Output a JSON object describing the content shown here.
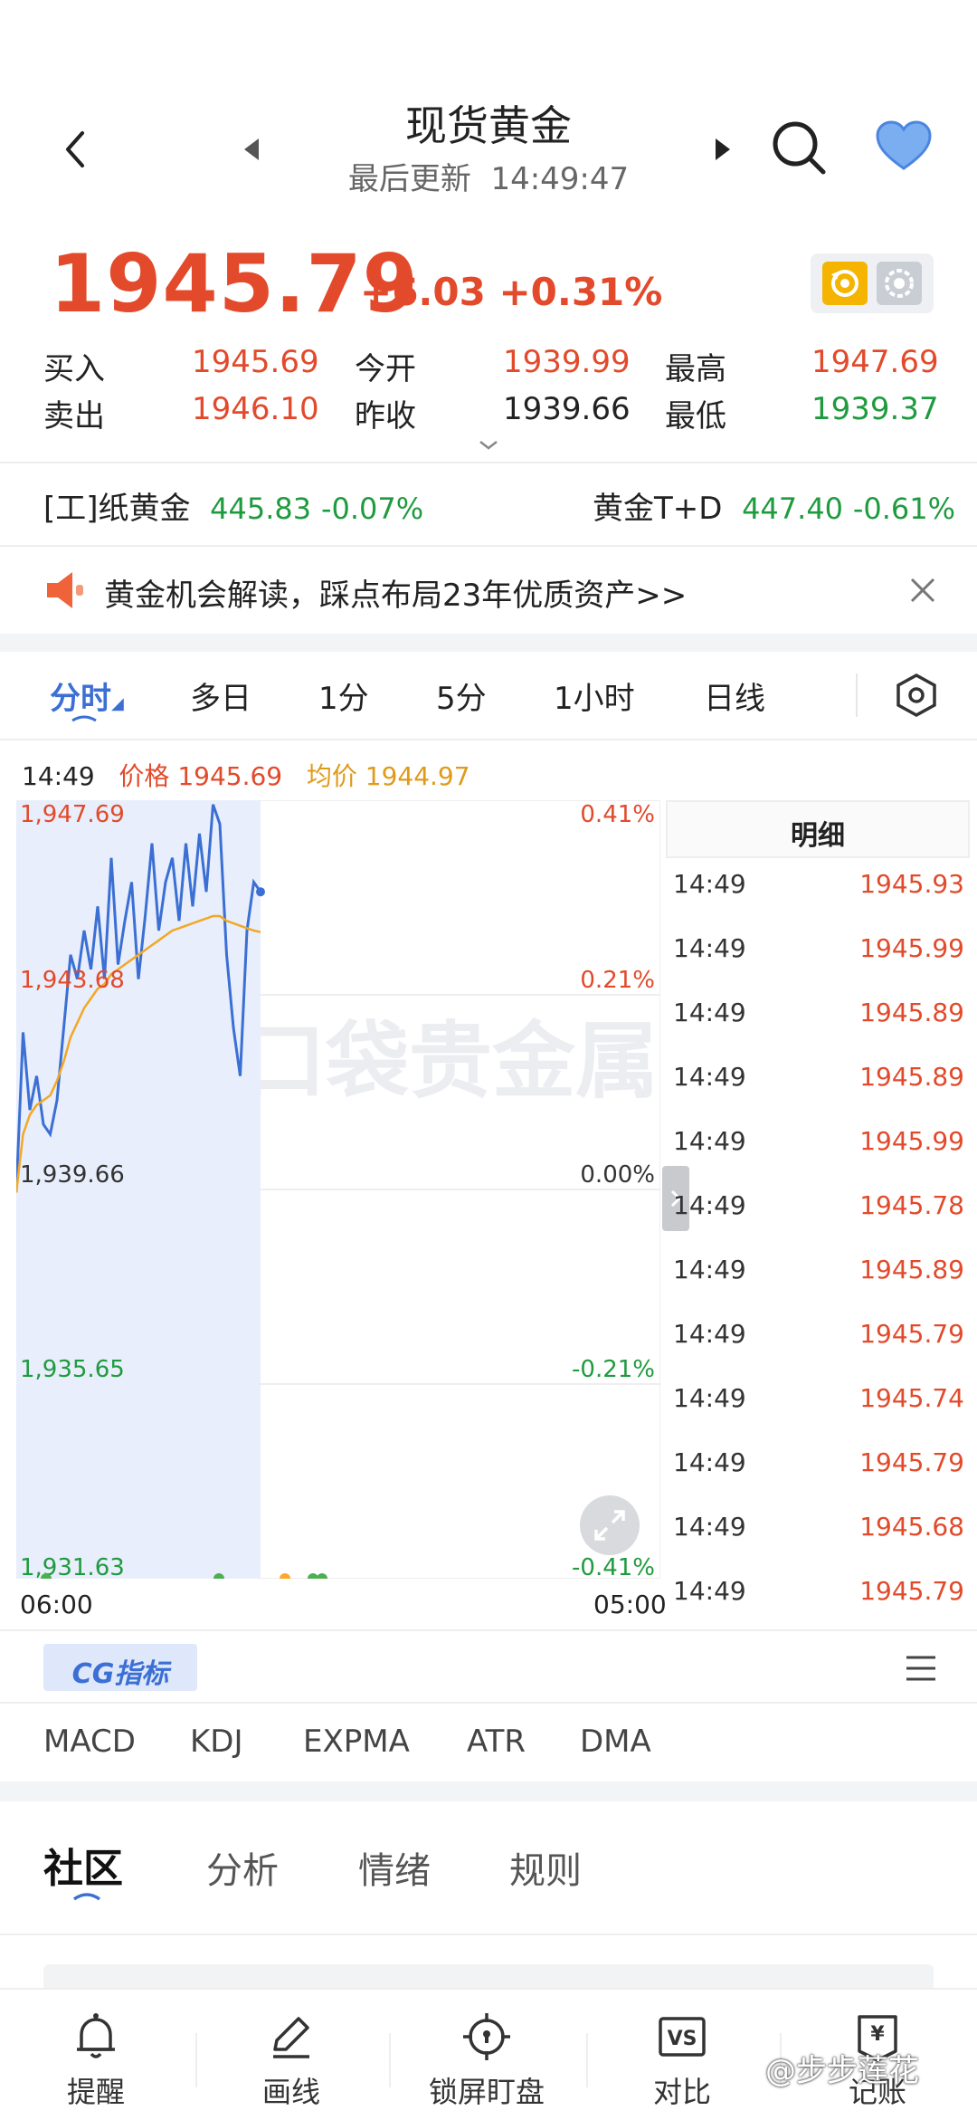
{
  "header": {
    "title": "现货黄金",
    "update_label": "最后更新",
    "update_time": "14:49:47"
  },
  "quote": {
    "price": "1945.79",
    "change": "+6.03",
    "change_pct": "+0.31%",
    "rows": [
      {
        "label": "买入",
        "value": "1945.69"
      },
      {
        "label": "今开",
        "value": "1939.99"
      },
      {
        "label": "最高",
        "value": "1947.69"
      },
      {
        "label": "卖出",
        "value": "1946.10"
      },
      {
        "label": "昨收",
        "value": "1939.66"
      },
      {
        "label": "最低",
        "value": "1939.37"
      }
    ]
  },
  "related": [
    {
      "name": "[工]纸黄金",
      "price": "445.83",
      "pct": "-0.07%"
    },
    {
      "name": "黄金T+D",
      "price": "447.40",
      "pct": "-0.61%"
    }
  ],
  "banner": {
    "text": "黄金机会解读，踩点布局23年优质资产>>"
  },
  "period_tabs": [
    "分时",
    "多日",
    "1分",
    "5分",
    "1小时",
    "日线"
  ],
  "chart_info": {
    "time": "14:49",
    "price_label": "价格",
    "price_value": "1945.69",
    "avg_label": "均价",
    "avg_value": "1944.97"
  },
  "chart_data": {
    "type": "line",
    "y_labels_left": [
      "1,947.69",
      "1,943.68",
      "1,939.66",
      "1,935.65",
      "1,931.63"
    ],
    "y_labels_right": [
      "0.41%",
      "0.21%",
      "0.00%",
      "-0.21%",
      "-0.41%"
    ],
    "x_labels": [
      "06:00",
      "05:00"
    ],
    "ylim": [
      1931.63,
      1947.69
    ],
    "watermark": "口袋贵金属",
    "series": [
      {
        "values": [
          1939.6,
          1942.9,
          1941.3,
          1942.0,
          1941.0,
          1940.8,
          1941.5,
          1943.0,
          1944.5,
          1944.0,
          1945.0,
          1944.2,
          1945.5,
          1944.0,
          1946.5,
          1944.3,
          1945.2,
          1946.0,
          1944.0,
          1945.3,
          1946.8,
          1945.0,
          1946.0,
          1946.5,
          1945.2,
          1946.8,
          1945.5,
          1947.0,
          1945.8,
          1947.6,
          1947.2,
          1944.5,
          1943.0,
          1942.0,
          1945.0,
          1946.0,
          1945.8
        ]
      },
      {
        "values": [
          1939.6,
          1940.8,
          1941.2,
          1941.4,
          1941.5,
          1941.6,
          1941.9,
          1942.3,
          1942.8,
          1943.1,
          1943.4,
          1943.6,
          1943.8,
          1943.9,
          1944.1,
          1944.2,
          1944.3,
          1944.4,
          1944.5,
          1944.6,
          1944.7,
          1944.8,
          1944.9,
          1945.0,
          1945.05,
          1945.1,
          1945.15,
          1945.2,
          1945.25,
          1945.3,
          1945.3,
          1945.2,
          1945.15,
          1945.1,
          1945.05,
          1945.0,
          1944.97
        ]
      }
    ]
  },
  "detail": {
    "title": "明细",
    "rows": [
      {
        "time": "14:49",
        "price": "1945.93"
      },
      {
        "time": "14:49",
        "price": "1945.99"
      },
      {
        "time": "14:49",
        "price": "1945.89"
      },
      {
        "time": "14:49",
        "price": "1945.89"
      },
      {
        "time": "14:49",
        "price": "1945.99"
      },
      {
        "time": "14:49",
        "price": "1945.78"
      },
      {
        "time": "14:49",
        "price": "1945.89"
      },
      {
        "time": "14:49",
        "price": "1945.79"
      },
      {
        "time": "14:49",
        "price": "1945.74"
      },
      {
        "time": "14:49",
        "price": "1945.79"
      },
      {
        "time": "14:49",
        "price": "1945.68"
      },
      {
        "time": "14:49",
        "price": "1945.79"
      }
    ]
  },
  "cg_badge": "CG指标",
  "indicators": [
    "MACD",
    "KDJ",
    "EXPMA",
    "ATR",
    "DMA"
  ],
  "community_tabs": [
    "社区",
    "分析",
    "情绪",
    "规则"
  ],
  "bottom_nav": [
    {
      "icon": "bell-icon",
      "label": "提醒"
    },
    {
      "icon": "pen-icon",
      "label": "画线"
    },
    {
      "icon": "lock-target-icon",
      "label": "锁屏盯盘"
    },
    {
      "icon": "vs-icon",
      "label": "对比"
    },
    {
      "icon": "ledger-icon",
      "label": "记账"
    }
  ],
  "watermark_user": "@步步莲花",
  "colors": {
    "red": "#e24a2b",
    "green": "#1f9b3f",
    "blue": "#3b6fd4",
    "avg_line": "#f2a825",
    "area": "#e8eefb"
  }
}
